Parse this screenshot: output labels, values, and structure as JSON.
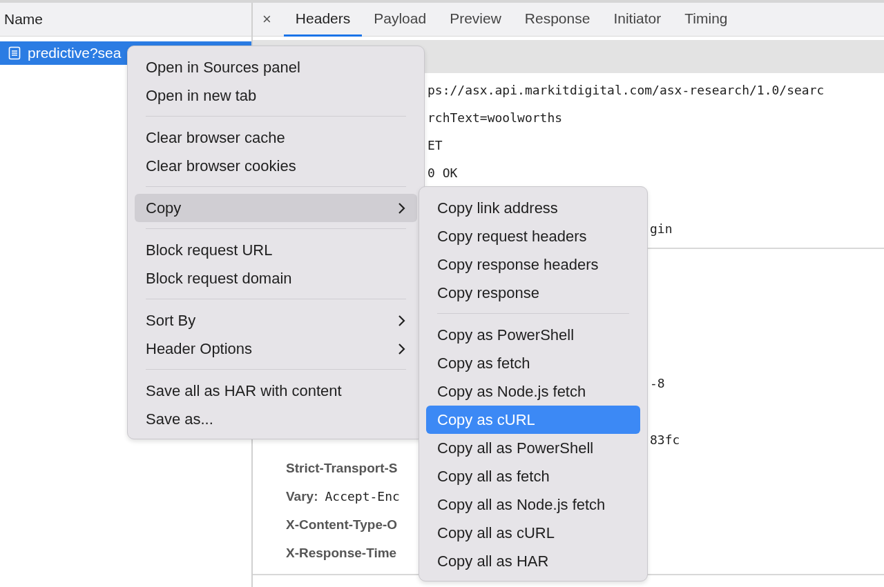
{
  "request_list": {
    "column": "Name",
    "rows": [
      {
        "name": "predictive?sea",
        "selected": true
      }
    ]
  },
  "detail_tabs": {
    "close": "×",
    "tabs": [
      {
        "label": "Headers",
        "selected": true
      },
      {
        "label": "Payload",
        "selected": false
      },
      {
        "label": "Preview",
        "selected": false
      },
      {
        "label": "Response",
        "selected": false
      },
      {
        "label": "Initiator",
        "selected": false
      },
      {
        "label": "Timing",
        "selected": false
      }
    ]
  },
  "general": {
    "rows": [
      {
        "value": "ps://asx.api.markitdigital.com/asx-research/1.0/searc"
      },
      {
        "value": "rchText=woolworths"
      },
      {
        "value": "ET"
      },
      {
        "value": "0 OK"
      },
      {
        "tail": "gin"
      }
    ]
  },
  "response_headers": {
    "rows": [
      {
        "tail": "-8"
      },
      {
        "tail": "83fc"
      },
      {
        "key": "Strict-Transport-S"
      },
      {
        "key": "Vary:",
        "value": "Accept-Enc"
      },
      {
        "key": "X-Content-Type-O"
      },
      {
        "key": "X-Response-Time"
      }
    ]
  },
  "context_menu": {
    "groups": [
      [
        {
          "label": "Open in Sources panel",
          "submenu": false,
          "selected": false
        },
        {
          "label": "Open in new tab",
          "submenu": false,
          "selected": false
        }
      ],
      [
        {
          "label": "Clear browser cache",
          "submenu": false,
          "selected": false
        },
        {
          "label": "Clear browser cookies",
          "submenu": false,
          "selected": false
        }
      ],
      [
        {
          "label": "Copy",
          "submenu": true,
          "selected": true
        }
      ],
      [
        {
          "label": "Block request URL",
          "submenu": false,
          "selected": false
        },
        {
          "label": "Block request domain",
          "submenu": false,
          "selected": false
        }
      ],
      [
        {
          "label": "Sort By",
          "submenu": true,
          "selected": false
        },
        {
          "label": "Header Options",
          "submenu": true,
          "selected": false
        }
      ],
      [
        {
          "label": "Save all as HAR with content",
          "submenu": false,
          "selected": false
        },
        {
          "label": "Save as...",
          "submenu": false,
          "selected": false
        }
      ]
    ]
  },
  "copy_submenu": {
    "groups": [
      [
        {
          "label": "Copy link address",
          "selected": false
        },
        {
          "label": "Copy request headers",
          "selected": false
        },
        {
          "label": "Copy response headers",
          "selected": false
        },
        {
          "label": "Copy response",
          "selected": false
        }
      ],
      [
        {
          "label": "Copy as PowerShell",
          "selected": false
        },
        {
          "label": "Copy as fetch",
          "selected": false
        },
        {
          "label": "Copy as Node.js fetch",
          "selected": false
        },
        {
          "label": "Copy as cURL",
          "selected": true
        },
        {
          "label": "Copy all as PowerShell",
          "selected": false
        },
        {
          "label": "Copy all as fetch",
          "selected": false
        },
        {
          "label": "Copy all as Node.js fetch",
          "selected": false
        },
        {
          "label": "Copy all as cURL",
          "selected": false
        },
        {
          "label": "Copy all as HAR",
          "selected": false
        }
      ]
    ]
  }
}
